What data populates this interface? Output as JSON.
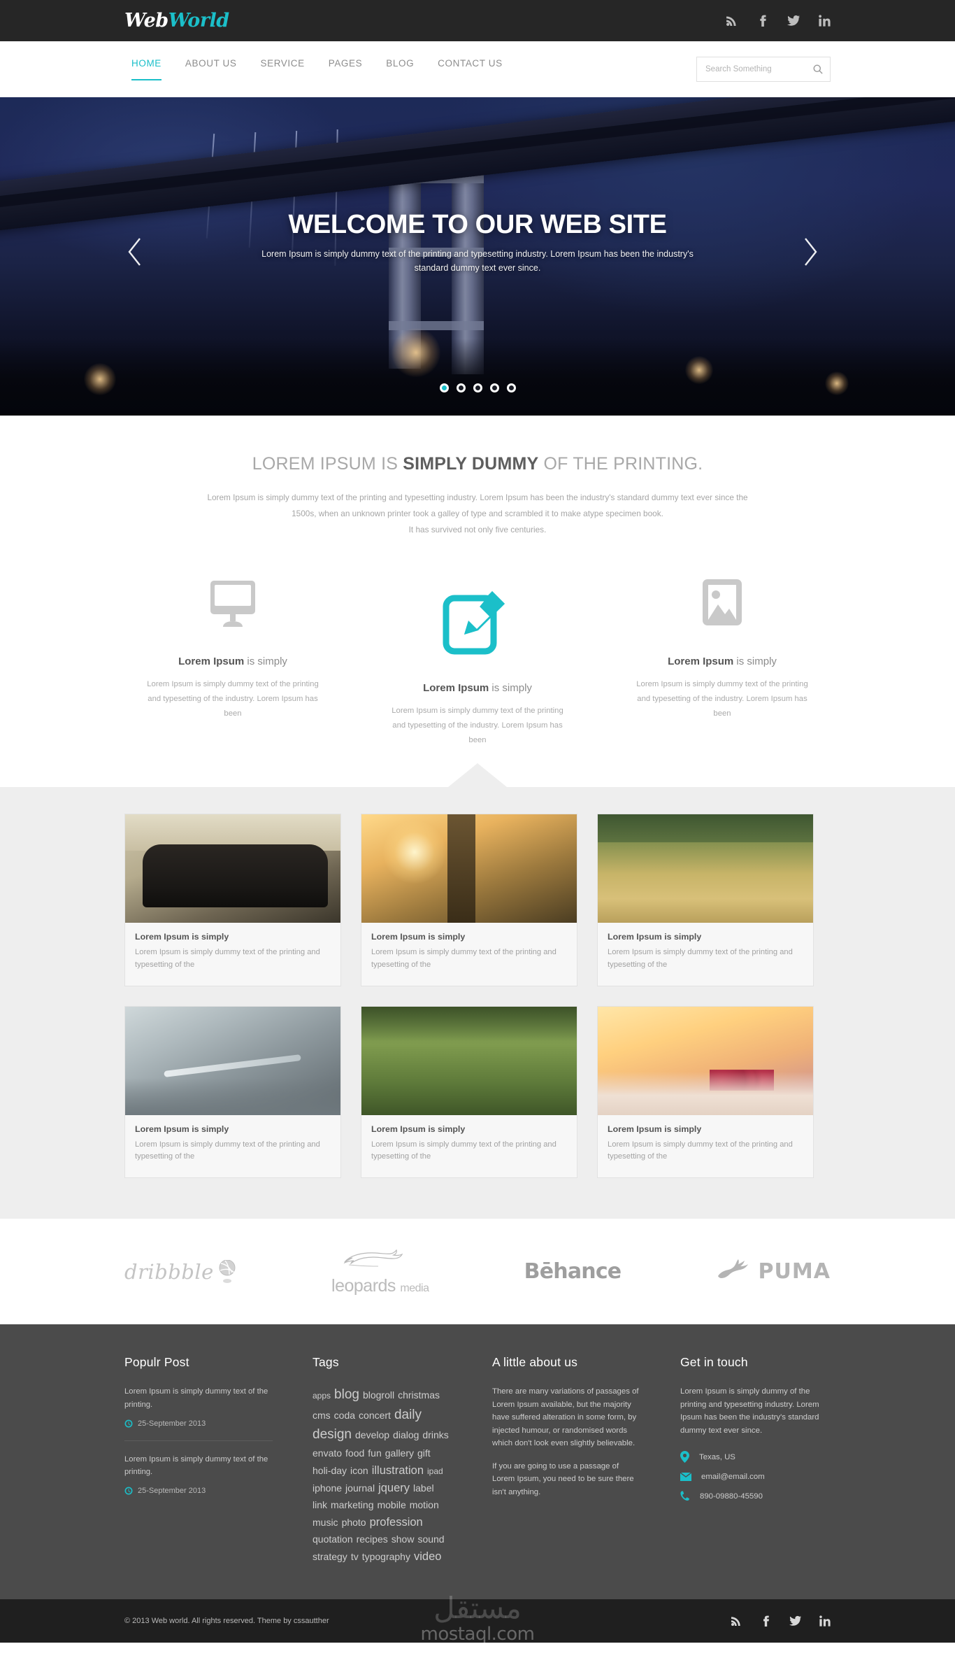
{
  "brand": {
    "name_part1": "Web",
    "name_part2": "World",
    "accent_color": "#1bbfc9"
  },
  "topbar": {
    "social": [
      {
        "name": "rss-icon",
        "label": "RSS"
      },
      {
        "name": "facebook-icon",
        "label": "Facebook"
      },
      {
        "name": "twitter-icon",
        "label": "Twitter"
      },
      {
        "name": "linkedin-icon",
        "label": "LinkedIn"
      }
    ]
  },
  "nav": {
    "items": [
      {
        "label": "HOME",
        "active": true
      },
      {
        "label": "ABOUT US",
        "active": false
      },
      {
        "label": "SERVICE",
        "active": false
      },
      {
        "label": "PAGES",
        "active": false
      },
      {
        "label": "BLOG",
        "active": false
      },
      {
        "label": "CONTACT US",
        "active": false
      }
    ]
  },
  "search": {
    "placeholder": "Search Something",
    "value": "",
    "icon": "search-icon"
  },
  "hero": {
    "title": "WELCOME TO OUR WEB SITE",
    "subtitle": "Lorem Ipsum is simply dummy text of the printing and typesetting industry. Lorem Ipsum has been the industry's standard dummy text ever since.",
    "prev_icon": "chevron-left-icon",
    "next_icon": "chevron-right-icon",
    "slide_count": 5,
    "active_slide": 1
  },
  "intro": {
    "heading_pre": "LOREM IPSUM IS ",
    "heading_bold": "SIMPLY DUMMY",
    "heading_post": " OF THE PRINTING.",
    "paragraph_line1": "Lorem Ipsum is simply dummy text of the printing and typesetting industry. Lorem Ipsum has been the industry's standard dummy text ever since the",
    "paragraph_line2": "1500s, when an unknown printer took a galley of type and scrambled it to make atype specimen book.",
    "paragraph_line3": "It has survived not only five centuries."
  },
  "features": [
    {
      "icon": "monitor-icon",
      "title_bold": "Lorem Ipsum",
      "title_rest": " is simply",
      "text": "Lorem Ipsum is simply dummy text of the printing and typesetting of the industry. Lorem Ipsum has been"
    },
    {
      "icon": "edit-pencil-icon",
      "title_bold": "Lorem Ipsum",
      "title_rest": " is simply",
      "text": "Lorem Ipsum is simply dummy text of the printing and typesetting of the industry. Lorem Ipsum has been"
    },
    {
      "icon": "image-icon",
      "title_bold": "Lorem Ipsum",
      "title_rest": " is simply",
      "text": "Lorem Ipsum is simply dummy text of the printing and typesetting of the industry. Lorem Ipsum has been"
    }
  ],
  "portfolio": {
    "items": [
      {
        "image": "vintage-car-photo",
        "title": "Lorem Ipsum is simply",
        "text": "Lorem Ipsum is simply dummy text of the printing and typesetting of the"
      },
      {
        "image": "sunrise-field-photo",
        "title": "Lorem Ipsum is simply",
        "text": "Lorem Ipsum is simply dummy text of the printing and typesetting of the"
      },
      {
        "image": "wheat-field-photo",
        "title": "Lorem Ipsum is simply",
        "text": "Lorem Ipsum is simply dummy text of the printing and typesetting of the"
      },
      {
        "image": "eyeglasses-photo",
        "title": "Lorem Ipsum is simply",
        "text": "Lorem Ipsum is simply dummy text of the printing and typesetting of the"
      },
      {
        "image": "green-wheat-photo",
        "title": "Lorem Ipsum is simply",
        "text": "Lorem Ipsum is simply dummy text of the printing and typesetting of the"
      },
      {
        "image": "raspberries-photo",
        "title": "Lorem Ipsum is simply",
        "text": "Lorem Ipsum is simply dummy text of the printing and typesetting of the"
      }
    ]
  },
  "brands": [
    {
      "name": "dribbble-logo",
      "label": "dribbble"
    },
    {
      "name": "leopards-media-logo",
      "label": "leopards",
      "sub": "media"
    },
    {
      "name": "behance-logo",
      "label": "Bēhance"
    },
    {
      "name": "puma-logo",
      "label": "PUMA"
    }
  ],
  "footer": {
    "popular": {
      "heading": "Populr Post",
      "posts": [
        {
          "text": "Lorem Ipsum is simply dummy text of the printing.",
          "date": "25-September 2013",
          "date_icon": "clock-icon"
        },
        {
          "text": "Lorem Ipsum is simply dummy text of the printing.",
          "date": "25-September 2013",
          "date_icon": "clock-icon"
        }
      ]
    },
    "tags": {
      "heading": "Tags",
      "items": [
        {
          "label": "apps",
          "size": "sm"
        },
        {
          "label": "blog",
          "size": "xl"
        },
        {
          "label": "blogroll",
          "size": "md"
        },
        {
          "label": "christmas",
          "size": "md"
        },
        {
          "label": "cms",
          "size": "md"
        },
        {
          "label": "coda",
          "size": "md"
        },
        {
          "label": "concert",
          "size": "md"
        },
        {
          "label": "daily",
          "size": "xl"
        },
        {
          "label": "design",
          "size": "xl"
        },
        {
          "label": "develop",
          "size": "md"
        },
        {
          "label": "dialog",
          "size": "md"
        },
        {
          "label": "drinks",
          "size": "md"
        },
        {
          "label": "envato",
          "size": "md"
        },
        {
          "label": "food",
          "size": "md"
        },
        {
          "label": "fun",
          "size": "md"
        },
        {
          "label": "gallery",
          "size": "md"
        },
        {
          "label": "gift",
          "size": "md"
        },
        {
          "label": "holi-day",
          "size": "md"
        },
        {
          "label": "icon",
          "size": "md"
        },
        {
          "label": "illustration",
          "size": "lg"
        },
        {
          "label": "ipad",
          "size": "sm"
        },
        {
          "label": "iphone",
          "size": "md"
        },
        {
          "label": "journal",
          "size": "md"
        },
        {
          "label": "jquery",
          "size": "lg"
        },
        {
          "label": "label",
          "size": "md"
        },
        {
          "label": "link",
          "size": "md"
        },
        {
          "label": "marketing",
          "size": "md"
        },
        {
          "label": "mobile",
          "size": "md"
        },
        {
          "label": "motion",
          "size": "md"
        },
        {
          "label": "music",
          "size": "md"
        },
        {
          "label": "photo",
          "size": "md"
        },
        {
          "label": "profession",
          "size": "lg"
        },
        {
          "label": "quotation",
          "size": "md"
        },
        {
          "label": "recipes",
          "size": "md"
        },
        {
          "label": "show",
          "size": "md"
        },
        {
          "label": "sound",
          "size": "md"
        },
        {
          "label": "strategy",
          "size": "md"
        },
        {
          "label": "tv",
          "size": "md"
        },
        {
          "label": "typography",
          "size": "md"
        },
        {
          "label": "video",
          "size": "lg"
        }
      ]
    },
    "about": {
      "heading": "A little about us",
      "paragraph1": "There are many variations of passages of Lorem Ipsum available, but the majority have suffered alteration in some form, by injected humour, or randomised words which don't look even slightly believable.",
      "paragraph2": "If you are going to use a passage of Lorem Ipsum, you need to be sure there isn't anything."
    },
    "contact": {
      "heading": "Get in touch",
      "intro": "Lorem Ipsum is simply dummy of the printing and typesetting industry. Lorem Ipsum has been the industry's standard dummy text ever since.",
      "lines": [
        {
          "icon": "location-pin-icon",
          "value": "Texas, US"
        },
        {
          "icon": "envelope-icon",
          "value": "email@email.com"
        },
        {
          "icon": "phone-icon",
          "value": "890-09880-45590"
        }
      ]
    }
  },
  "bottom": {
    "copyright": "© 2013 Web world. All rights reserved. Theme by cssautther",
    "social": [
      {
        "name": "rss-icon",
        "label": "RSS"
      },
      {
        "name": "facebook-icon",
        "label": "Facebook"
      },
      {
        "name": "twitter-icon",
        "label": "Twitter"
      },
      {
        "name": "linkedin-icon",
        "label": "LinkedIn"
      }
    ]
  },
  "watermark": {
    "arabic": "مستقل",
    "latin": "mostaql.com"
  }
}
